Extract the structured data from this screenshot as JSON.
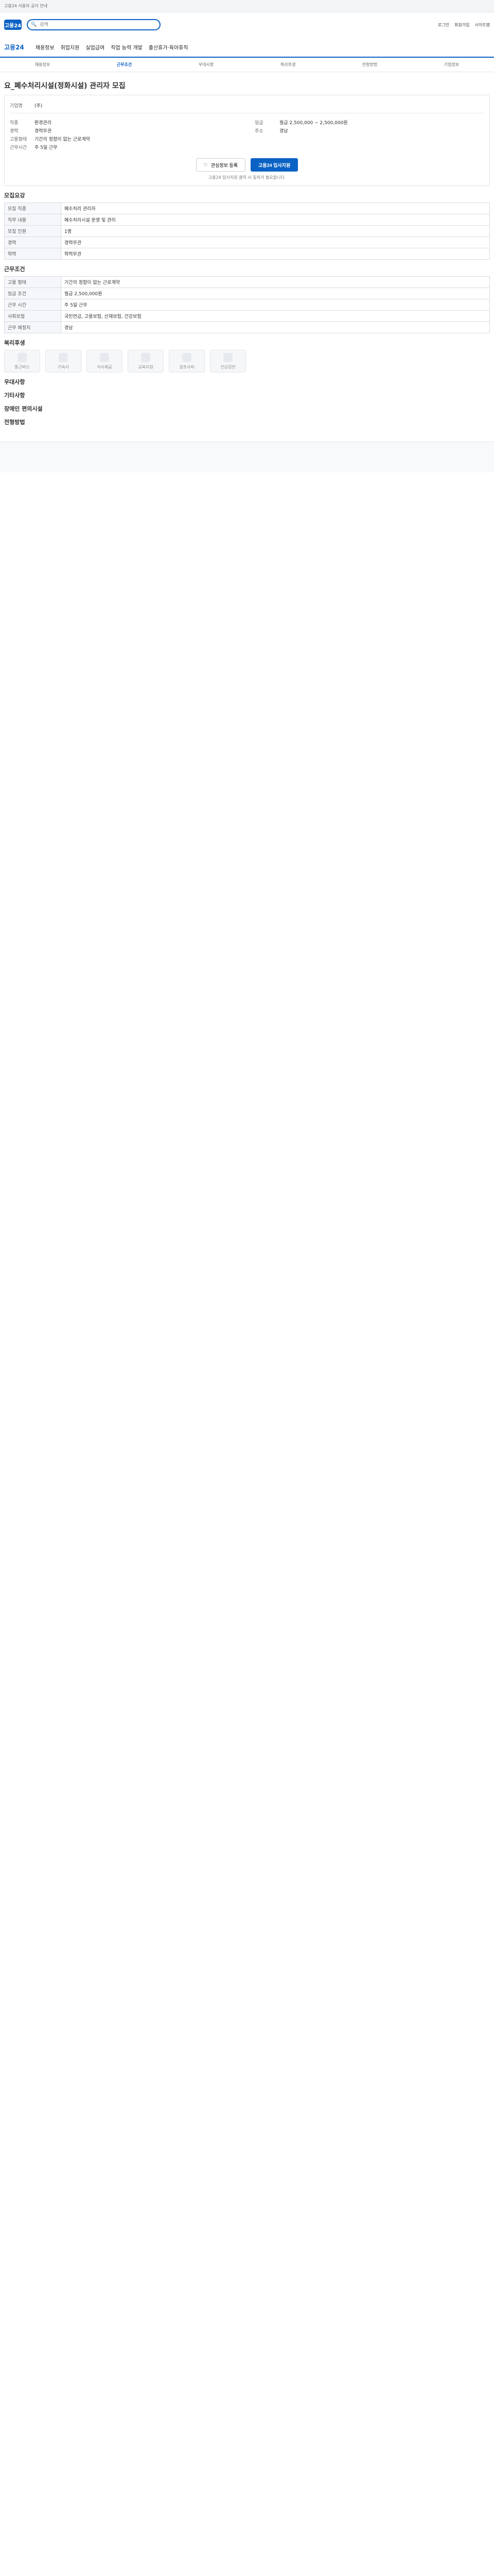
{
  "topbar": {
    "note": "고용24 사용자 공지 안내"
  },
  "header": {
    "logo": "고용24",
    "search_placeholder": "검색",
    "right_links": [
      "로그인",
      "회원가입",
      "사이트맵"
    ]
  },
  "gnb": {
    "brand": "고용24",
    "items": [
      "채용정보",
      "취업지원",
      "실업급여",
      "직업 능력 개발",
      "출산휴가·육아휴직"
    ]
  },
  "subnav": {
    "items": [
      "채용정보",
      "근무조건",
      "우대사항",
      "복리후생",
      "전형방법",
      "기업정보"
    ],
    "active": 1
  },
  "job": {
    "title": "요_폐수처리시설(정화시설) 관리자 모집",
    "company": "(주)",
    "left": [
      {
        "k": "직종",
        "v": "환경관리"
      },
      {
        "k": "경력",
        "v": "경력무관"
      }
    ],
    "right": [
      {
        "k": "임금",
        "v": "월급 2,500,000 ~ 2,500,000원"
      },
      {
        "k": "주소",
        "v": "경남"
      }
    ],
    "employ": {
      "k": "고용형태",
      "v": "기간의 정함이 없는 근로계약"
    },
    "worktime": {
      "k": "근무시간",
      "v": "주 5일 근무"
    },
    "btn_scrap": "관심정보 등록",
    "btn_apply": "고용24 입사지원",
    "note": "고용24 입사지원 클릭 시 동의가 필요합니다."
  },
  "sections": {
    "recruit": "모집요강",
    "conditions": "근무조건",
    "preference": "우대사항",
    "other": "기타사항",
    "benefits": "복리후생",
    "disabled": "장애인 편의시설",
    "process": "전형방법"
  },
  "table1": [
    {
      "k": "모집 직종",
      "v": "폐수처리 관리자"
    },
    {
      "k": "직무 내용",
      "v": "폐수처리시설 운영 및 관리"
    },
    {
      "k": "모집 인원",
      "v": "1명"
    },
    {
      "k": "경력",
      "v": "경력무관"
    },
    {
      "k": "학력",
      "v": "학력무관"
    }
  ],
  "table2": [
    {
      "k": "고용 형태",
      "v": "기간의 정함이 없는 근로계약"
    },
    {
      "k": "임금 조건",
      "v": "월급 2,500,000원"
    },
    {
      "k": "근무 시간",
      "v": "주 5일 근무"
    },
    {
      "k": "사회보험",
      "v": "국민연금, 고용보험, 산재보험, 건강보험"
    },
    {
      "k": "근무 예정지",
      "v": "경남"
    }
  ],
  "benefit_tiles": [
    "통근버스",
    "기숙사",
    "식사제공",
    "교육지원",
    "경조사비",
    "건강검진"
  ]
}
